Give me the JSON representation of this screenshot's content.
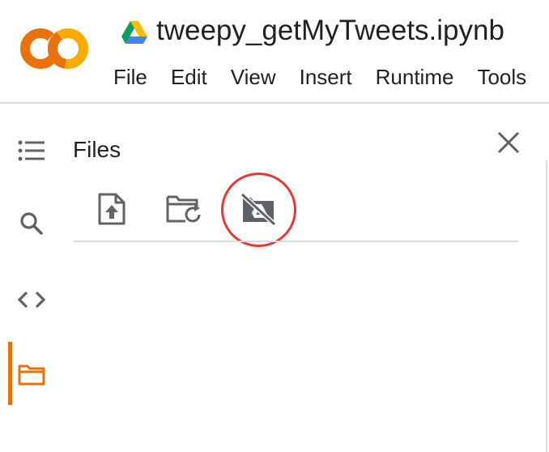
{
  "document": {
    "title": "tweepy_getMyTweets.ipynb"
  },
  "menu": {
    "items": [
      "File",
      "Edit",
      "View",
      "Insert",
      "Runtime",
      "Tools"
    ]
  },
  "rail": {
    "items": [
      {
        "icon": "table-of-contents-icon"
      },
      {
        "icon": "search-icon"
      },
      {
        "icon": "code-snippets-icon"
      },
      {
        "icon": "folder-icon",
        "active": true
      }
    ]
  },
  "panel": {
    "title": "Files",
    "tools": [
      {
        "icon": "upload-file-icon"
      },
      {
        "icon": "refresh-folder-icon"
      },
      {
        "icon": "mount-drive-icon",
        "highlighted": true
      }
    ]
  },
  "colors": {
    "accent": "#e8710a",
    "logo_light": "#f9ab00",
    "highlight": "#e53935",
    "icon": "#5f6368",
    "divider": "#dadce0"
  }
}
